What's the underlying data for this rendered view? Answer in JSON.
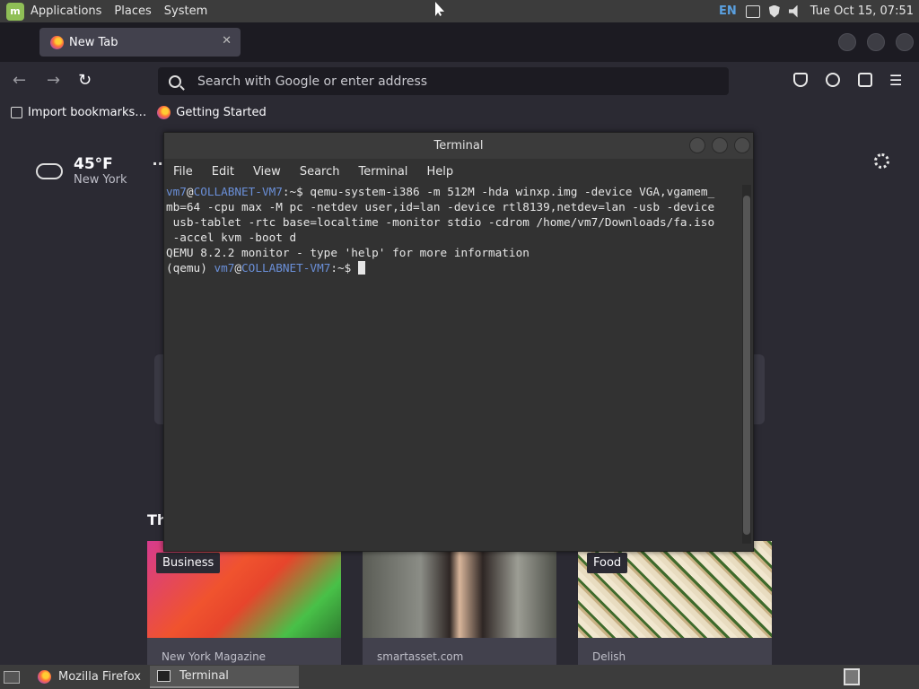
{
  "top_panel": {
    "menu": [
      "Applications",
      "Places",
      "System"
    ],
    "keyboard_layout": "EN",
    "clock": "Tue Oct 15, 07:51"
  },
  "browser": {
    "tab_title": "New Tab",
    "tab_close": "✕",
    "url_placeholder": "Search with Google or enter address",
    "bookmarks": [
      "Import bookmarks…",
      "Getting Started"
    ],
    "nav": {
      "back": "←",
      "forward": "→",
      "reload": "↻",
      "menu": "☰"
    }
  },
  "newtab": {
    "weather_temp": "45°F",
    "weather_city": "New York",
    "more_dots": "··",
    "section_title": "Th",
    "stories": [
      {
        "category": "Business",
        "source": "New York Magazine"
      },
      {
        "category": "",
        "source": "smartasset.com"
      },
      {
        "category": "Food",
        "source": "Delish"
      }
    ]
  },
  "terminal": {
    "title": "Terminal",
    "menu": [
      "File",
      "Edit",
      "View",
      "Search",
      "Terminal",
      "Help"
    ],
    "prompt_user": "vm7",
    "prompt_at": "@",
    "prompt_host": "COLLABNET-VM7",
    "prompt_sep": ":~$",
    "command_line_1": " qemu-system-i386 -m 512M -hda winxp.img -device VGA,vgamem_",
    "command_line_2": "mb=64 -cpu max -M pc -netdev user,id=lan -device rtl8139,netdev=lan -usb -device",
    "command_line_3": " usb-tablet -rtc base=localtime -monitor stdio -cdrom /home/vm7/Downloads/fa.iso",
    "command_line_4": " -accel kvm -boot d",
    "output_line": "QEMU 8.2.2 monitor - type 'help' for more information",
    "qemu_prompt": "(qemu) "
  },
  "taskbar": {
    "items": [
      "Mozilla Firefox",
      "Terminal"
    ]
  },
  "colors": {
    "terminal_bg": "#323232",
    "prompt_blue": "#6a8fd8",
    "browser_bg": "#2b2a33",
    "panel_bg": "#3c3c3c"
  }
}
